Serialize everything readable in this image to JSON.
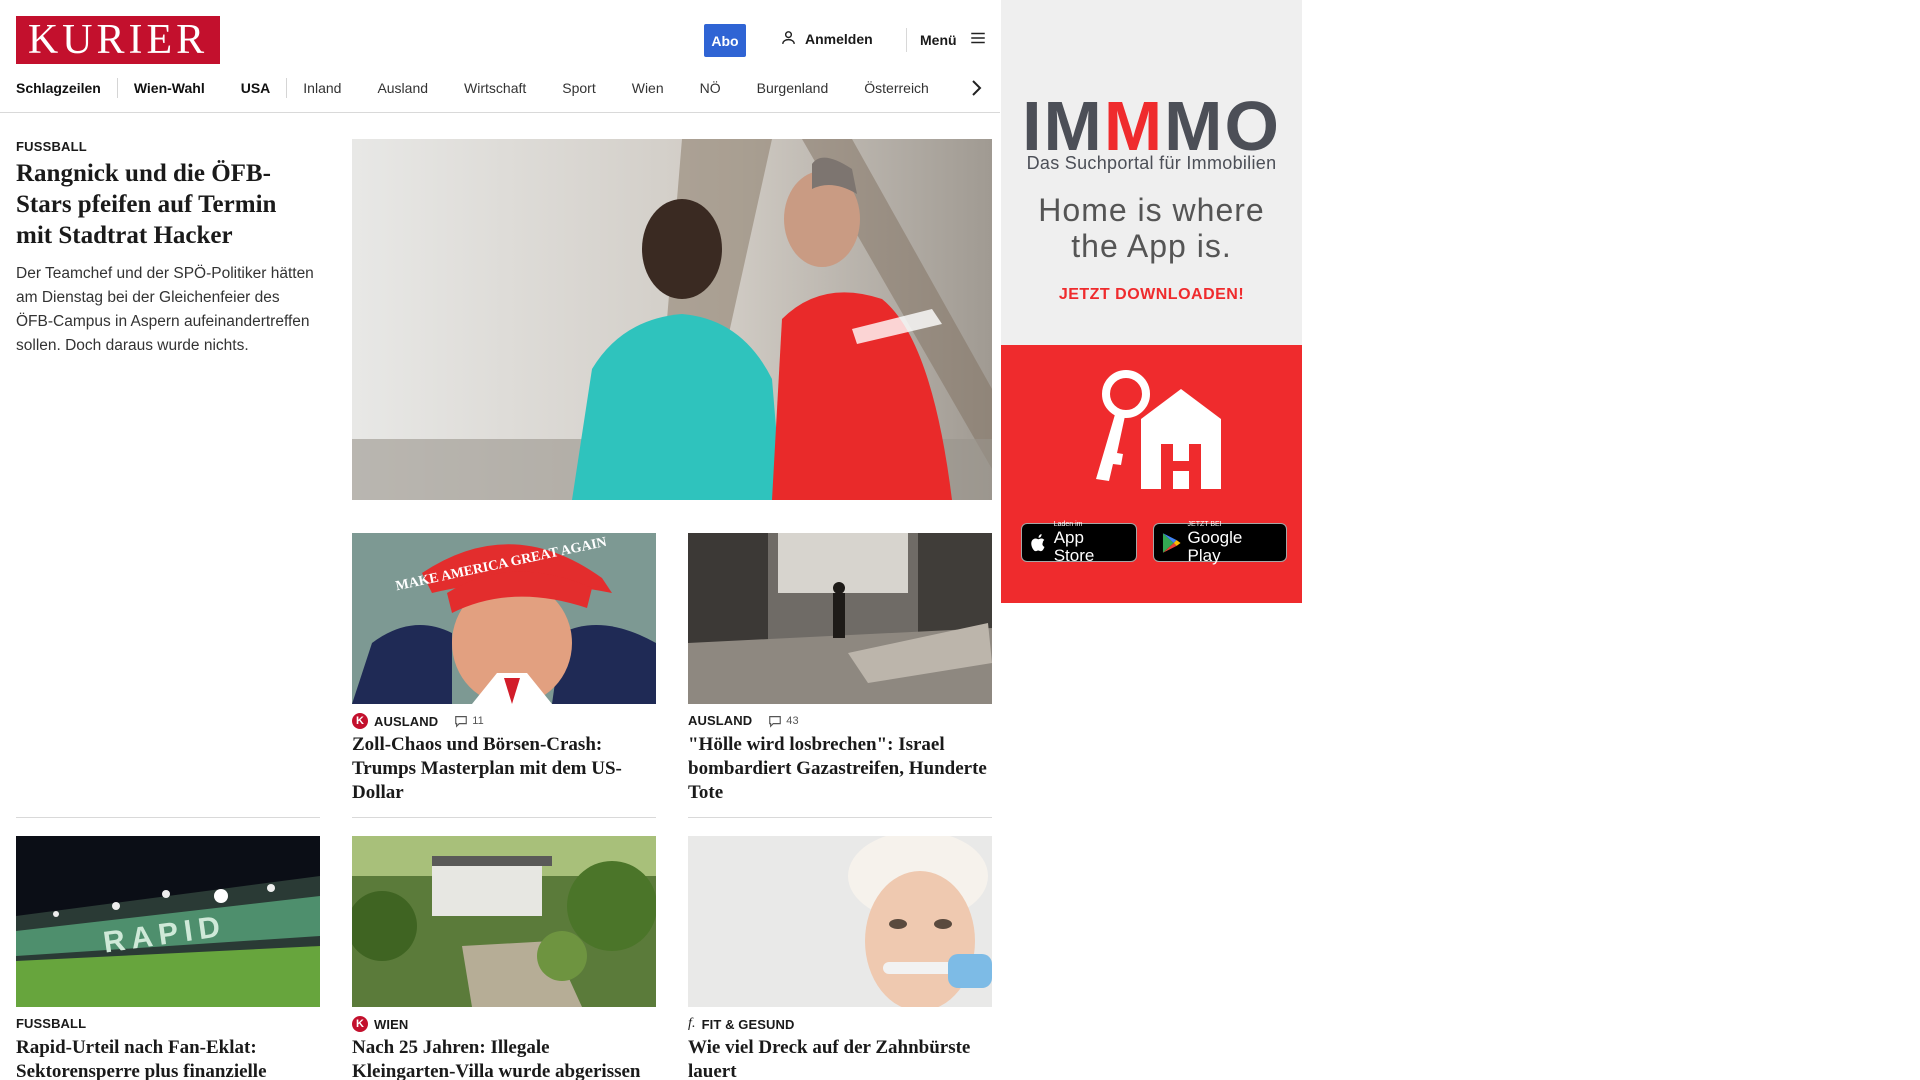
{
  "header": {
    "logo": "KURIER",
    "abo_label": "Abo",
    "login_label": "Anmelden",
    "menu_label": "Menü"
  },
  "nav": {
    "items": [
      "Schlagzeilen",
      "Wien-Wahl",
      "USA",
      "Inland",
      "Ausland",
      "Wirtschaft",
      "Sport",
      "Wien",
      "NÖ",
      "Burgenland",
      "Österreich"
    ]
  },
  "lead": {
    "category": "FUSSBALL",
    "title": "Rangnick und die ÖFB-Stars pfeifen auf Termin mit Stadtrat Hacker",
    "teaser": "Der Teamchef und der SPÖ-Politiker hätten am Dienstag bei der Gleichenfeier des ÖFB-Campus in Aspern aufeinandertreffen sollen. Doch daraus wurde nichts."
  },
  "articles": [
    {
      "category": "AUSLAND",
      "comments": "11",
      "badge": "K",
      "title": "Zoll-Chaos und Börsen-Crash: Trumps Masterplan mit dem US-Dollar",
      "cap_text": "MAKE AMERICA GREAT AGAIN"
    },
    {
      "category": "AUSLAND",
      "comments": "43",
      "title": "\"Hölle wird losbrechen\": Israel bombardiert Gazastreifen, Hunderte Tote"
    },
    {
      "category": "FUSSBALL",
      "title": "Rapid-Urteil nach Fan-Eklat: Sektorensperre plus finanzielle Höchststrafe",
      "stadium_text": "RAPID"
    },
    {
      "category": "WIEN",
      "badge": "K",
      "title": "Nach 25 Jahren: Illegale Kleingarten-Villa wurde abgerissen"
    },
    {
      "category": "FIT & GESUND",
      "badge": "f.",
      "title": "Wie viel Dreck auf der Zahnbürste lauert"
    }
  ],
  "ad": {
    "brand_parts": [
      "IM",
      "M",
      "MO"
    ],
    "subtitle": "Das Suchportal für Immobilien",
    "headline": "Home is where the App is.",
    "cta": "JETZT DOWNLOADEN!",
    "appstore_small": "Laden im",
    "appstore_big": "App Store",
    "googleplay_small": "JETZT BEI",
    "googleplay_big": "Google Play"
  },
  "colors": {
    "brand": "#c3102d",
    "abo": "#2f64d4",
    "ad_red": "#ef2b2d"
  }
}
